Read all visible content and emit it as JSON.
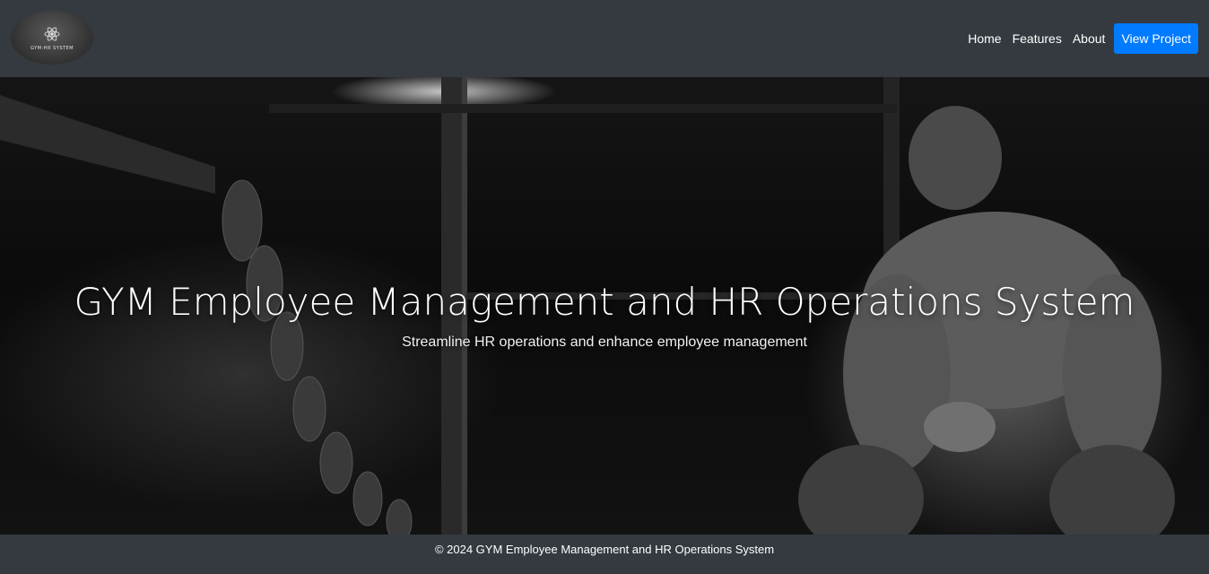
{
  "header": {
    "logo_text": "GYM-HR SYSTEM",
    "nav": [
      {
        "label": "Home"
      },
      {
        "label": "Features"
      },
      {
        "label": "About"
      }
    ],
    "cta_label": "View Project",
    "cta_color": "#007bff"
  },
  "hero": {
    "title": "GYM Employee Management and HR Operations System",
    "subtitle": "Streamline HR operations and enhance employee management"
  },
  "footer": {
    "text": "© 2024 GYM Employee Management and HR Operations System"
  },
  "colors": {
    "navbar_bg": "#343a40",
    "text": "#ffffff"
  },
  "icons": {
    "logo": "atom-icon"
  }
}
